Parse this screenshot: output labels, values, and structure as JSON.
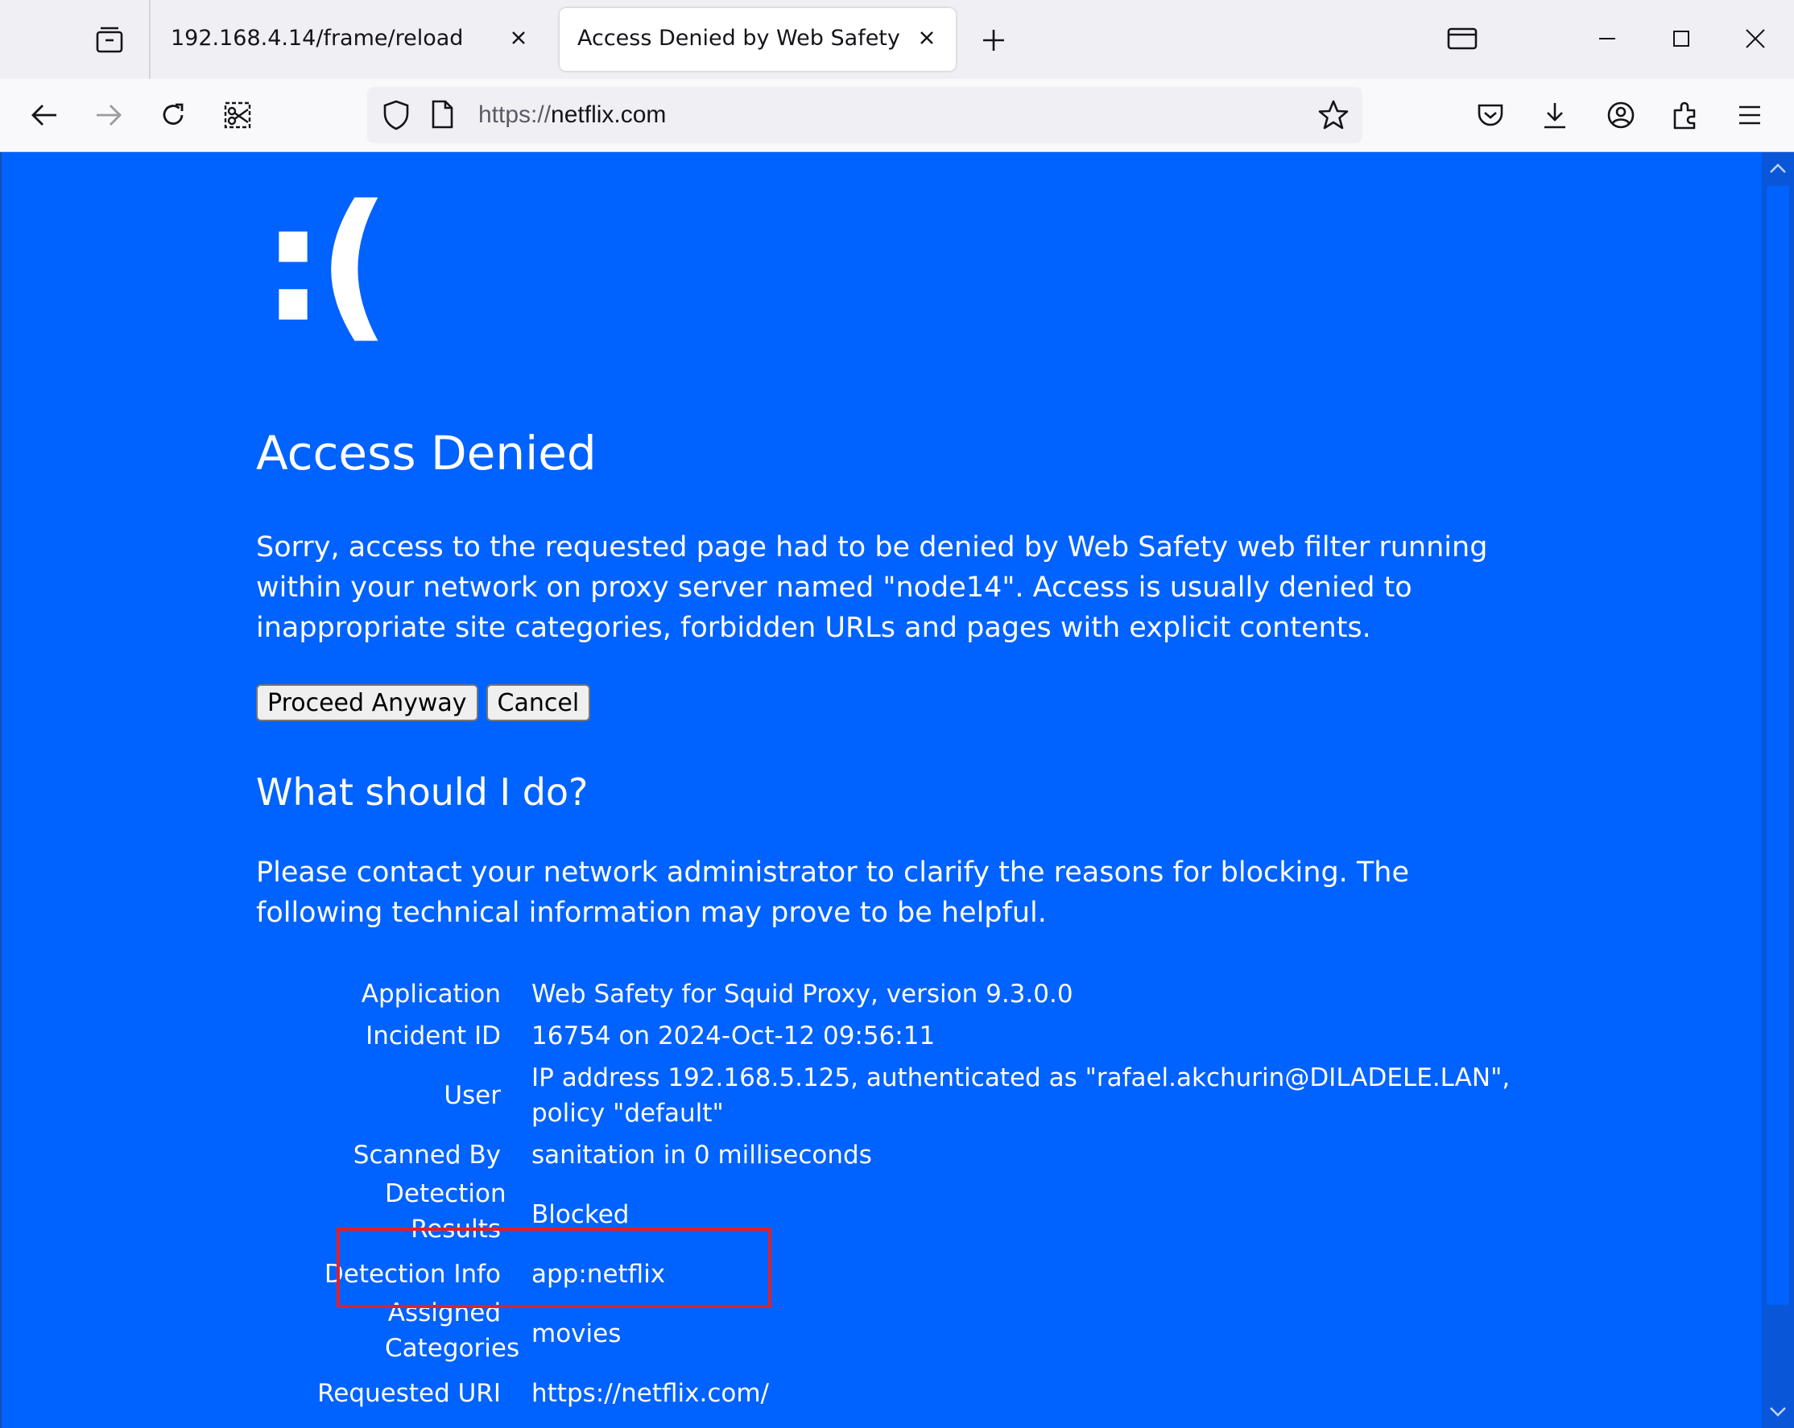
{
  "browser": {
    "tabs": [
      {
        "title": "192.168.4.14/frame/reload",
        "active": false
      },
      {
        "title": "Access Denied by Web Safety",
        "active": true
      }
    ],
    "url": {
      "protocol": "https://",
      "host": "netflix.com"
    },
    "icons": {
      "tab_list": "tab-list-icon",
      "new_tab": "plus-icon",
      "tabs_view": "window-icon",
      "minimize": "minimize-icon",
      "maximize": "maximize-icon",
      "close": "close-icon",
      "back": "back-arrow-icon",
      "forward": "forward-arrow-icon",
      "reload": "reload-icon",
      "screenshot": "screenshot-icon",
      "shield": "shield-icon",
      "page": "page-icon",
      "bookmark": "star-icon",
      "pocket": "pocket-icon",
      "downloads": "download-icon",
      "account": "account-icon",
      "extensions": "extensions-icon",
      "menu": "hamburger-menu-icon"
    }
  },
  "page": {
    "background": "#0062ff",
    "highlight_color": "#e0202a",
    "frown": ":(",
    "title": "Access Denied",
    "lead": "Sorry, access to the requested page had to be denied by Web Safety web filter running within your network on proxy server named \"node14\". Access is usually denied to inappropriate site categories, forbidden URLs and pages with explicit contents.",
    "buttons": {
      "proceed": "Proceed Anyway",
      "cancel": "Cancel"
    },
    "subtitle": "What should I do?",
    "help": "Please contact your network administrator to clarify the reasons for blocking. The following technical information may prove to be helpful.",
    "info": [
      {
        "label": "Application",
        "value": "Web Safety for Squid Proxy, version 9.3.0.0"
      },
      {
        "label": "Incident ID",
        "value": "16754 on 2024-Oct-12 09:56:11"
      },
      {
        "label": "User",
        "value": "IP address 192.168.5.125, authenticated as \"rafael.akchurin@DILADELE.LAN\", policy \"default\""
      },
      {
        "label": "Scanned By",
        "value": "sanitation in 0 milliseconds"
      },
      {
        "label": "Detection Results",
        "value": "Blocked"
      },
      {
        "label": "Detection Info",
        "value": "app:netflix"
      },
      {
        "label": "Assigned Categories",
        "value": "movies"
      },
      {
        "label": "Requested URI",
        "value": "https://netflix.com/"
      }
    ]
  }
}
